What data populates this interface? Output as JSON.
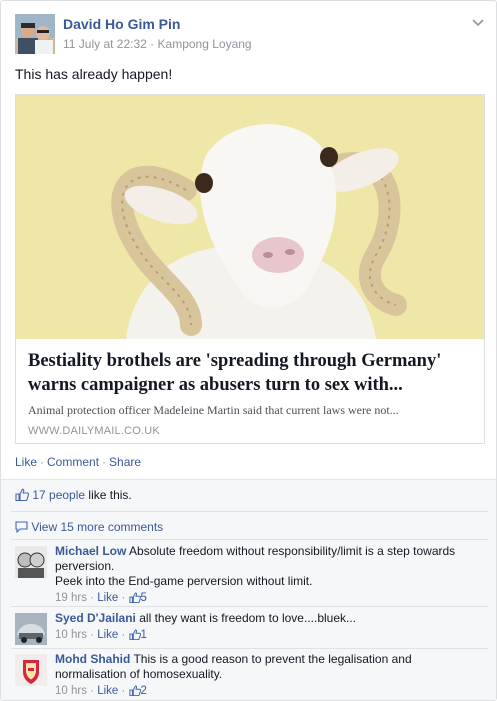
{
  "post": {
    "author": "David Ho Gim Pin",
    "date": "11 July at 22:32",
    "meta_sep": " · ",
    "location": "Kampong Loyang",
    "text": "This has already happen!"
  },
  "link": {
    "title": "Bestiality brothels are 'spreading through Germany' warns campaigner as abusers turn to sex with...",
    "description": "Animal protection officer Madeleine Martin said that current laws were not...",
    "domain": "WWW.DAILYMAIL.CO.UK"
  },
  "actions": {
    "like": "Like",
    "comment": "Comment",
    "share": "Share",
    "dot": "·"
  },
  "feedback": {
    "likes_count": "17 people",
    "likes_suffix": " like this.",
    "view_more": "View 15 more comments"
  },
  "comments": [
    {
      "name": "Michael Low",
      "text": "Absolute freedom without responsibility/limit is a step towards perversion.",
      "text2": "Peek into the End-game perversion without limit.",
      "time": "19 hrs",
      "like": "Like",
      "likes": "5"
    },
    {
      "name": "Syed D'Jailani",
      "text": "all they want is freedom to love....bluek...",
      "time": "10 hrs",
      "like": "Like",
      "likes": "1"
    },
    {
      "name": "Mohd Shahid",
      "text": "This is a good reason to prevent the legalisation and normalisation of homosexuality.",
      "time": "10 hrs",
      "like": "Like",
      "likes": "2"
    }
  ],
  "colors": {
    "link_blue": "#3b5998",
    "meta_gray": "#90949c",
    "feedback_bg": "#f6f7f9"
  }
}
